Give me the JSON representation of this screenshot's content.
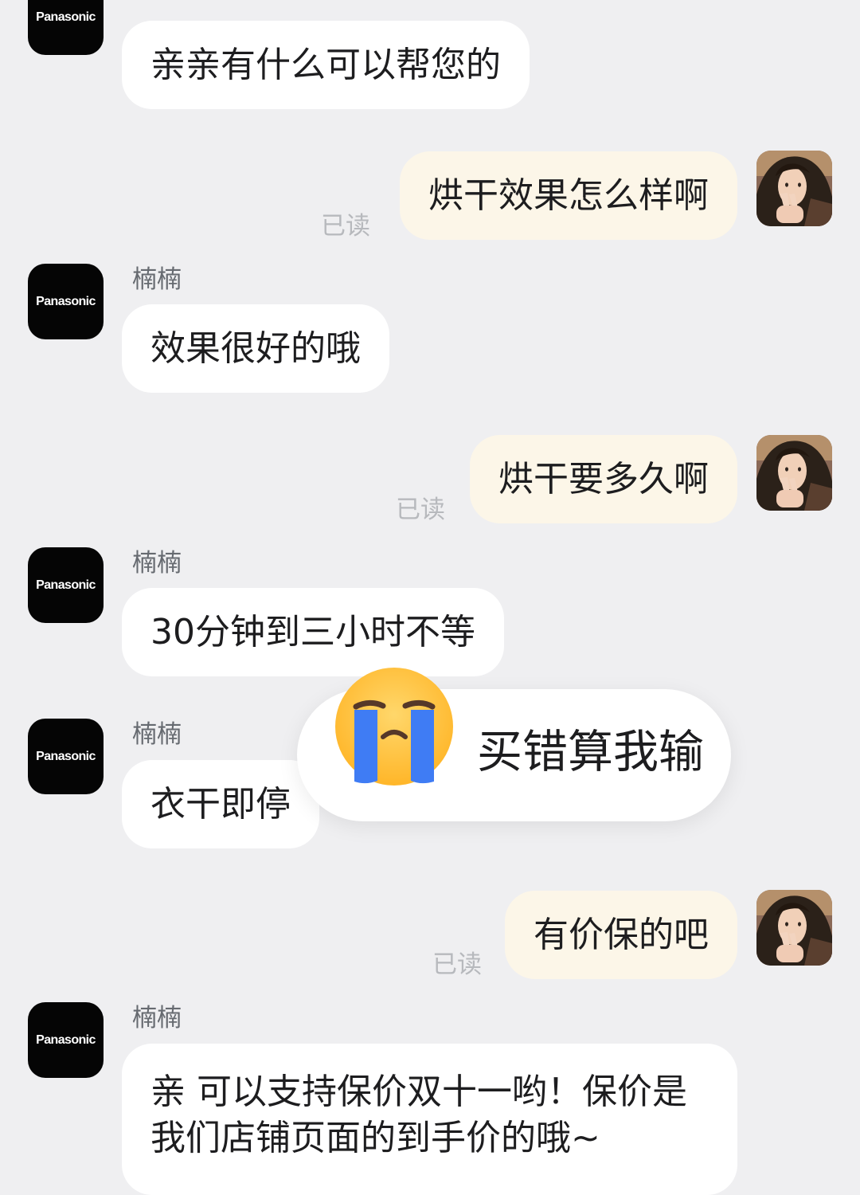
{
  "brand": {
    "logo_text": "Panasonic",
    "sender_name": "楠楠"
  },
  "icons": {
    "brand_avatar": "panasonic-avatar-icon",
    "user_avatar": "user-profile-photo-icon",
    "popup_emoji": "crying-face-emoji-icon"
  },
  "conversation": {
    "messages": [
      {
        "side": "left",
        "text": "亲亲有什么可以帮您的"
      },
      {
        "side": "right",
        "text": "烘干效果怎么样啊",
        "status": "已读"
      },
      {
        "side": "left",
        "sender": "楠楠",
        "text": "效果很好的哦"
      },
      {
        "side": "right",
        "text": "烘干要多久啊",
        "status": "已读"
      },
      {
        "side": "left",
        "sender": "楠楠",
        "text": "30分钟到三小时不等"
      },
      {
        "side": "left",
        "sender": "楠楠",
        "text": "衣干即停"
      },
      {
        "side": "right",
        "text": "有价保的吧",
        "status": "已读"
      },
      {
        "side": "left",
        "sender": "楠楠",
        "text": "亲 可以支持保价双十一哟！保价是我们店铺页面的到手价的哦~"
      }
    ]
  },
  "overlay": {
    "caption": "买错算我输",
    "colors": {
      "popup_background": "#ffffff",
      "emoji_face": "#ffc533",
      "emoji_tears": "#3f7cf4"
    }
  },
  "colors": {
    "page_background": "#efeff1",
    "left_bubble": "#ffffff",
    "right_bubble": "#fcf6e8",
    "brand_avatar_background": "#050505",
    "secondary_text": "#666a70",
    "read_receipt_text": "#b7b9bd"
  }
}
